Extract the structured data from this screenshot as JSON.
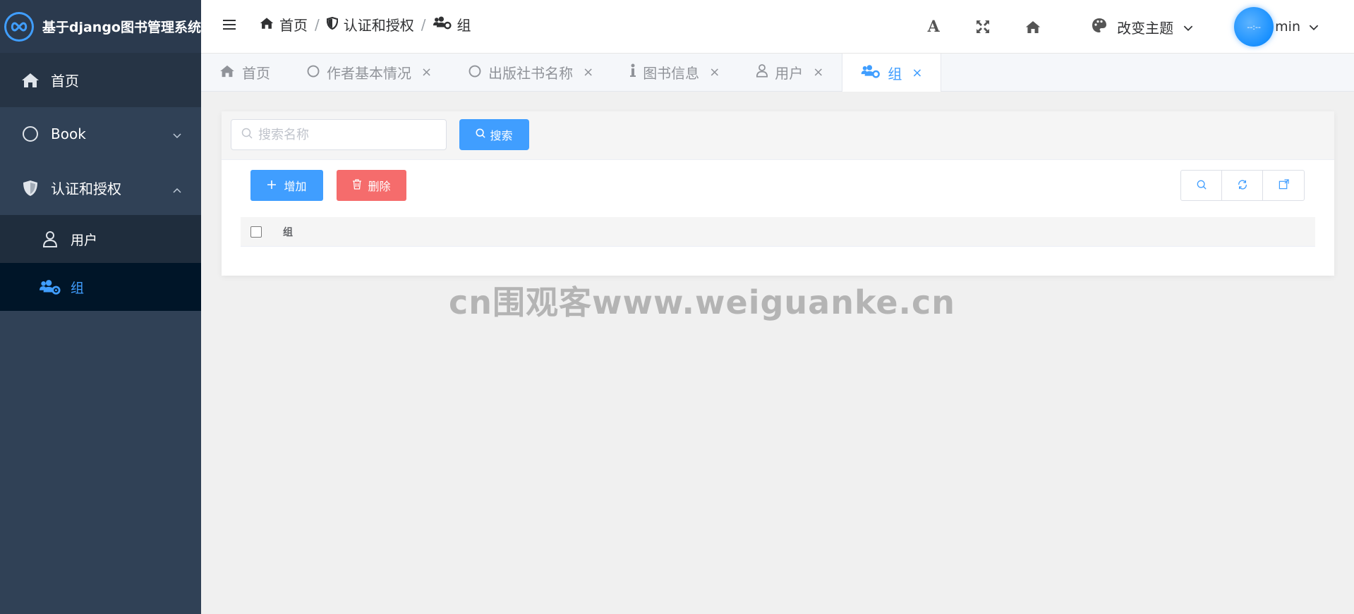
{
  "brand": {
    "title": "基于django图书管理系统",
    "logo_icon": "infinity-icon"
  },
  "sidebar": {
    "items": [
      {
        "label": "首页",
        "icon": "home-icon"
      },
      {
        "label": "Book",
        "icon": "circle-icon"
      },
      {
        "label": "认证和授权",
        "icon": "shield-icon",
        "children": [
          {
            "label": "用户",
            "icon": "user-icon"
          },
          {
            "label": "组",
            "icon": "users-cog-icon",
            "active": true
          }
        ]
      }
    ],
    "colors": {
      "bg": "#304156",
      "active_bg": "#001528",
      "active_text": "#409eff"
    }
  },
  "breadcrumb": [
    {
      "label": "首页",
      "icon": "home-icon"
    },
    {
      "label": "认证和授权",
      "icon": "shield-icon"
    },
    {
      "label": "组",
      "icon": "users-cog-icon"
    }
  ],
  "header": {
    "theme_label": "改变主题",
    "avatar_text": "--:--",
    "user_name": "min"
  },
  "tabs": [
    {
      "label": "首页",
      "icon": "home-icon",
      "closable": false
    },
    {
      "label": "作者基本情况",
      "icon": "circle-icon",
      "closable": true
    },
    {
      "label": "出版社书名称",
      "icon": "circle-icon",
      "closable": true
    },
    {
      "label": "图书信息",
      "icon": "info-icon",
      "closable": true
    },
    {
      "label": "用户",
      "icon": "user-icon",
      "closable": true
    },
    {
      "label": "组",
      "icon": "users-cog-icon",
      "closable": true,
      "active": true
    }
  ],
  "search": {
    "placeholder": "搜索名称",
    "value": "",
    "button_label": "搜索"
  },
  "toolbar": {
    "add_label": "增加",
    "delete_label": "删除"
  },
  "table": {
    "columns": [
      "组"
    ],
    "rows": []
  },
  "watermark": "cn围观客www.weiguanke.cn",
  "colors": {
    "primary": "#409eff",
    "danger": "#f56c6c"
  }
}
